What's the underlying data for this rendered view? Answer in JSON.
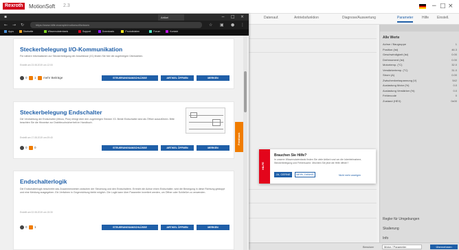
{
  "app": {
    "logo": "Rexroth",
    "title": "MotionSoft",
    "version": "2.3",
    "tabs": [
      "Datenauf.",
      "Antriebsfunktion",
      "Diagnose/Auswertung",
      "Parameter",
      "Hilfe",
      "Einstell."
    ]
  },
  "properties": {
    "section": "Alle Werte",
    "rows": [
      {
        "label": "Achse / Baugruppe",
        "value": "1"
      },
      {
        "label": "Position (Ist)",
        "value": "46.3"
      },
      {
        "label": "Geschwindigkeit (Ist)",
        "value": "0.00"
      },
      {
        "label": "Drehmoment (Ist)",
        "value": "0.00"
      },
      {
        "label": "Motortemp. (°C)",
        "value": "32.0"
      },
      {
        "label": "Verstärkertemp. (°C)",
        "value": "31.0"
      },
      {
        "label": "Strom (A)",
        "value": "0.00"
      },
      {
        "label": "Zwischenkreisspannung (V)",
        "value": "542"
      },
      {
        "label": "Auslastung Motor (%)",
        "value": "0.0"
      },
      {
        "label": "Auslastung Verstärker (%)",
        "value": "0.0"
      },
      {
        "label": "Fehlercode",
        "value": "0"
      },
      {
        "label": "Zustand (HEX)",
        "value": "0x00"
      }
    ],
    "bottom": [
      "Regler für Umgebungen",
      "Skalierung",
      "Info"
    ]
  },
  "statusbar": {
    "label": "Benutzer",
    "select": "Motor / Parameter",
    "button": "Übernehmen"
  },
  "popup": {
    "band": "HILFE",
    "title": "Brauchen Sie Hilfe?",
    "text": "In unserer Wissensdatenbank finden Sie viele Artikel rund um die Inbetriebnahme, Steckerbelegung und Fehlersuche. Möchten Sie jetzt die Hilfe öffnen?",
    "yes": "JA, GERNE",
    "no": "NEIN, DANKE",
    "link": "Nicht mehr anzeigen"
  },
  "browser": {
    "tab": "Artikel",
    "url": "https://www.hilfe.example/motionsoft/wissen",
    "bookmarks": [
      "Apps",
      "Startseite",
      "Wissensdatenbank",
      "Support",
      "Downloads",
      "Produktdaten",
      "Forum",
      "Kontakt"
    ]
  },
  "articles": [
    {
      "title": "Steckerbelegung I/O-Kommunikation",
      "desc": "Für nähere Informationen zur Steckerbelegung der Anschlüsse (X1) finden Sie hier die zugehörigen Übersichten.",
      "date": "Erstellt am 23.08.2019 um 12:00",
      "comments": "0",
      "likes": "1",
      "extra": "mehr Beiträge",
      "buttons": [
        "STEUERUNGSANSCHLÜSSE",
        "ARTIKEL ÖFFNEN",
        "MERKEN"
      ]
    },
    {
      "title": "Steckerbelegung Endschalter",
      "desc": "Die Verdrahtung der Endschalter (Minus, Plus) erfolgt über den zugehörigen Stecker X3. Beide Endschalter sind als Öffner auszuführen. Bitte beachten Sie die Hinweise zur Drahtbruchsicherheit im Handbuch.",
      "date": "Erstellt am 17.08.2019 um 09:40",
      "comments": "0",
      "likes": "0",
      "buttons": [
        "STEUERUNGSANSCHLÜSSE",
        "ARTIKEL ÖFFNEN",
        "MERKEN"
      ]
    },
    {
      "title": "Endschalterlogik",
      "desc": "Die Endschalterlogik beschreibt das Zusammenwirken zwischen der Steuerung und den Endschaltern. Erreicht die Achse einen Endschalter, wird die Bewegung in diese Richtung gestoppt und eine Meldung ausgegeben. Ein Verfahren in Gegenrichtung bleibt möglich. Die Logik kann über Parameter invertiert werden, um Öffner oder Schließer zu verwenden.",
      "date": "Erstellt am 02.08.2019 um 15:30",
      "comments": "0",
      "likes": "1",
      "buttons": [
        "STEUERUNGSANSCHLÜSSE",
        "ARTIKEL ÖFFNEN",
        "MERKEN"
      ]
    }
  ],
  "feedback_tab": "Feedback"
}
